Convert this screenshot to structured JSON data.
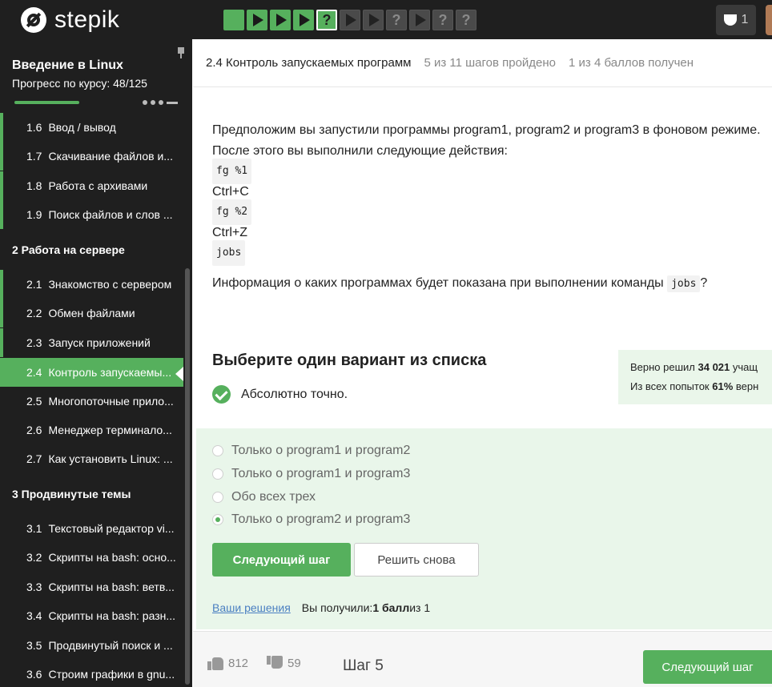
{
  "topbar": {
    "logo_text": "stepik",
    "steps": [
      {
        "type": "text",
        "status": "done"
      },
      {
        "type": "video",
        "status": "done"
      },
      {
        "type": "video",
        "status": "done"
      },
      {
        "type": "video",
        "status": "done"
      },
      {
        "type": "quiz",
        "status": "done",
        "current": true,
        "glyph": "?"
      },
      {
        "type": "video",
        "status": "pending"
      },
      {
        "type": "video",
        "status": "pending"
      },
      {
        "type": "quiz",
        "status": "pending",
        "glyph": "?"
      },
      {
        "type": "video",
        "status": "pending"
      },
      {
        "type": "quiz",
        "status": "pending",
        "glyph": "?"
      },
      {
        "type": "quiz",
        "status": "pending",
        "glyph": "?"
      }
    ],
    "notifications_count": "1"
  },
  "sidebar": {
    "course_title": "Введение в Linux",
    "progress_label": "Прогресс по курсу:  48/125",
    "progress": 0.384,
    "lessons_top": [
      {
        "num": "1.6",
        "title": "Ввод / вывод"
      },
      {
        "num": "1.7",
        "title": "Скачивание файлов и..."
      },
      {
        "num": "1.8",
        "title": "Работа с архивами"
      },
      {
        "num": "1.9",
        "title": "Поиск файлов и слов ..."
      }
    ],
    "section2": "2  Работа на сервере",
    "lessons_s2": [
      {
        "num": "2.1",
        "title": "Знакомство с сервером"
      },
      {
        "num": "2.2",
        "title": "Обмен файлами"
      },
      {
        "num": "2.3",
        "title": "Запуск приложений"
      },
      {
        "num": "2.4",
        "title": "Контроль запускаемы..."
      },
      {
        "num": "2.5",
        "title": "Многопоточные прило..."
      },
      {
        "num": "2.6",
        "title": "Менеджер терминало..."
      },
      {
        "num": "2.7",
        "title": "Как установить Linux: ..."
      }
    ],
    "section3": "3  Продвинутые темы",
    "lessons_s3": [
      {
        "num": "3.1",
        "title": "Текстовый редактор vi..."
      },
      {
        "num": "3.2",
        "title": "Скрипты на bash: осно..."
      },
      {
        "num": "3.3",
        "title": "Скрипты на bash: ветв..."
      },
      {
        "num": "3.4",
        "title": "Скрипты на bash: разн..."
      },
      {
        "num": "3.5",
        "title": "Продвинутый поиск и ..."
      },
      {
        "num": "3.6",
        "title": "Строим графики в gnu..."
      }
    ]
  },
  "header": {
    "lesson_title": "2.4 Контроль запускаемых программ",
    "steps_done": "5 из 11 шагов пройдено",
    "points": "1 из 4 баллов  получен"
  },
  "task": {
    "intro1": "Предположим вы запустили программы program1, program2 и program3 в фоновом режиме.",
    "intro2": "После этого вы выполнили следующие действия:",
    "cmd1": "fg %1",
    "line2": "Ctrl+C",
    "cmd2": "fg %2",
    "line4": "Ctrl+Z",
    "cmd3": "jobs",
    "question_before": "Информация о каких программах будет показана при выполнении команды ",
    "question_code": "jobs",
    "question_after": "?"
  },
  "quiz": {
    "pick_title": "Выберите один вариант из списка",
    "verdict": "Абсолютно точно.",
    "stats_line1_prefix": "Верно решил ",
    "stats_solvers": "34 021",
    "stats_line1_suffix": " учащ",
    "stats_line2_prefix": "Из всех попыток ",
    "stats_rate": "61%",
    "stats_line2_suffix": " верн",
    "options": [
      "Только о program1 и program2",
      "Только о program1 и program3",
      "Обо всех трех",
      "Только о program2 и program3"
    ],
    "selected_index": 3,
    "next_button": "Следующий шаг",
    "retry_button": "Решить снова",
    "solutions_link": "Ваши решения",
    "score_prefix": "Вы получили: ",
    "score_value": "1 балл",
    "score_suffix": " из 1"
  },
  "footer": {
    "likes": "812",
    "dislikes": "59",
    "step_label": "Шаг 5",
    "next_button": "Следующий шаг"
  },
  "colors": {
    "accent": "#56b05d",
    "dark": "#1f1f1f",
    "answer_bg": "#e9f6ea"
  }
}
